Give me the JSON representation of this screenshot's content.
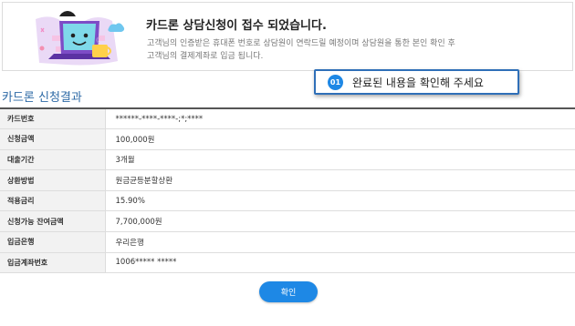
{
  "notice": {
    "title": "카드론 상담신청이 접수 되었습니다.",
    "desc_line1": "고객님의 인증받은 휴대폰 번호로 상담원이 연락드릴 예정이며 상담원을 통한 본인 확인 후",
    "desc_line2": "고객님의 결제계좌로 입금 됩니다."
  },
  "callout": {
    "number": "01",
    "text": "완료된 내용을 확인해 주세요"
  },
  "section_title": "카드론 신청결과",
  "result": {
    "rows": [
      {
        "label": "카드번호",
        "value": "******-****-****-;*;****"
      },
      {
        "label": "신청금액",
        "value": "100,000원"
      },
      {
        "label": "대출기간",
        "value": "3개월"
      },
      {
        "label": "상환방법",
        "value": "원금균등분할상환"
      },
      {
        "label": "적용금리",
        "value": "15.90%"
      },
      {
        "label": "신청가능 잔여금액",
        "value": "7,700,000원"
      },
      {
        "label": "입금은행",
        "value": "우리은행"
      },
      {
        "label": "입금계좌번호",
        "value": "1006***** *****"
      }
    ]
  },
  "confirm_label": "확인",
  "colors": {
    "accent": "#1e88e5",
    "section_title": "#2e6aa6",
    "callout_border": "#2f6fb8"
  }
}
